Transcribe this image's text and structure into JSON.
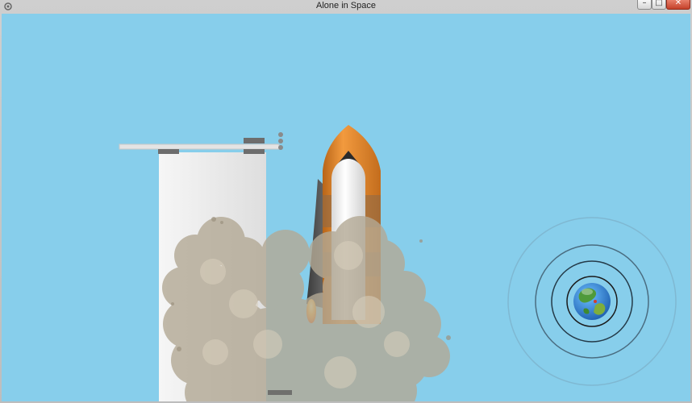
{
  "window": {
    "title": "Alone in Space",
    "controls": {
      "minimize": "–",
      "maximize": "□",
      "close": "✕"
    }
  },
  "scene": {
    "sky_color": "#87ceeb",
    "tower_color": "#eeeeee",
    "shuttle_nose_color": "#e07f24",
    "smoke_color": "#b0a692",
    "planet_icon": "earth-icon"
  }
}
